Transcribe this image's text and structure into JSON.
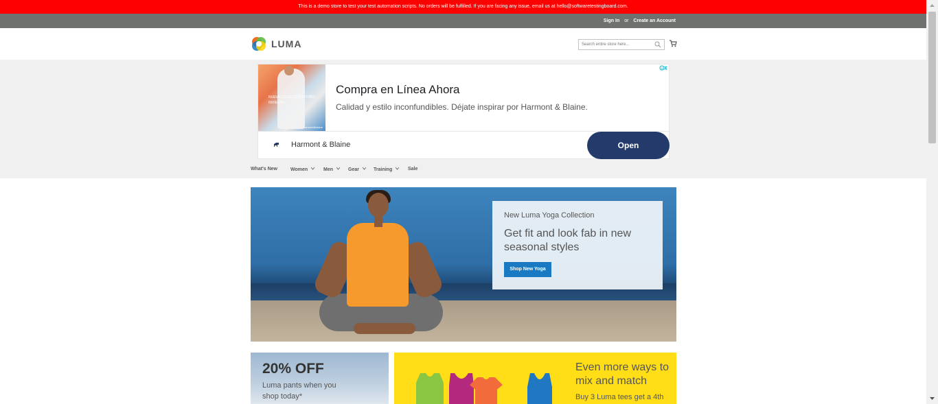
{
  "demo_notice": "This is a demo store to test your test automation scripts. No orders will be fulfilled. If you are facing any issue, email us at hello@softwaretestingboard.com.",
  "panel": {
    "sign_in": "Sign In",
    "or": "or",
    "create_account": "Create an Account"
  },
  "header": {
    "logo_text": "LUMA",
    "search_placeholder": "Search entire store here...",
    "search_icon": "search-icon",
    "cart_icon": "cart-icon"
  },
  "ad": {
    "title": "Compra en Línea Ahora",
    "description": "Calidad y estilo inconfundibles. Déjate inspirar por Harmont & Blaine.",
    "brand": "Harmont & Blaine",
    "button": "Open",
    "brand_logo_text": "harmont&blaine",
    "image_text": "NUEVA COLECCIÓN OTOÑO-INVIERNO",
    "image_brand": "harmont&blaine"
  },
  "nav": {
    "items": [
      {
        "label": "What's New",
        "has_menu": false
      },
      {
        "label": "Women",
        "has_menu": true
      },
      {
        "label": "Men",
        "has_menu": true
      },
      {
        "label": "Gear",
        "has_menu": true
      },
      {
        "label": "Training",
        "has_menu": true
      },
      {
        "label": "Sale",
        "has_menu": false
      }
    ]
  },
  "hero": {
    "kicker": "New Luma Yoga Collection",
    "title": "Get fit and look fab in new seasonal styles",
    "button": "Shop New Yoga"
  },
  "promo_left": {
    "title": "20% OFF",
    "subtitle": "Luma pants when you shop today*"
  },
  "promo_right": {
    "title": "Even more ways to mix and match",
    "subtitle": "Buy 3 Luma tees get a 4th"
  },
  "colors": {
    "demo_bar": "#ff0000",
    "panel": "#6e716e",
    "button_blue": "#1979c3",
    "ad_button": "#243a6b",
    "promo_yellow": "#ffdd17"
  }
}
